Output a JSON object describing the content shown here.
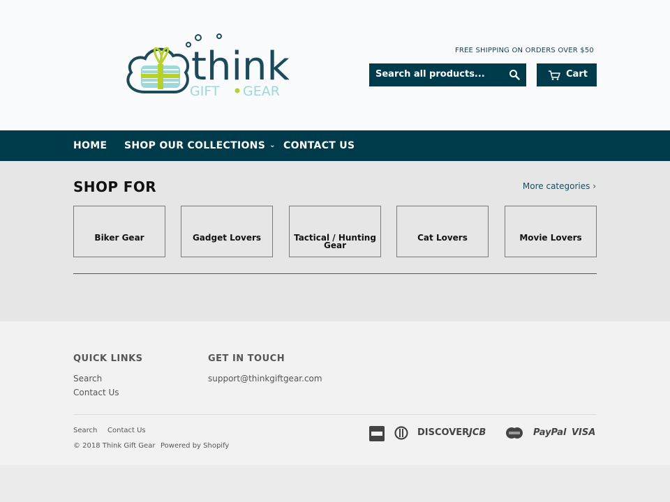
{
  "header": {
    "logo": {
      "word": "think",
      "tagline_left": "GIFT",
      "tagline_right": "GEAR"
    },
    "shipping_note": "FREE SHIPPING ON ORDERS OVER $50",
    "search_placeholder": "Search all products...",
    "cart_label": "Cart"
  },
  "nav": {
    "items": [
      {
        "label": "HOME"
      },
      {
        "label": "SHOP OUR COLLECTIONS"
      },
      {
        "label": "CONTACT US"
      }
    ]
  },
  "main": {
    "title": "SHOP FOR",
    "more_link": "More categories ›",
    "categories": [
      {
        "label": "Biker Gear"
      },
      {
        "label": "Gadget Lovers"
      },
      {
        "label": "Tactical / Hunting Gear"
      },
      {
        "label": "Cat Lovers"
      },
      {
        "label": "Movie Lovers"
      }
    ]
  },
  "footer": {
    "quick_links_heading": "QUICK LINKS",
    "quick_links": [
      "Search",
      "Contact Us"
    ],
    "contact_heading": "GET IN TOUCH",
    "email": "support@thinkgiftgear.com",
    "bottom_links": [
      "Search",
      "Contact Us"
    ],
    "copyright": "© 2018 Think Gift Gear",
    "powered_by": "Powered by Shopify",
    "payment_icons": [
      "american-express",
      "diners-club",
      "discover",
      "jcb",
      "master",
      "paypal",
      "visa"
    ],
    "payment_labels": {
      "discover": "DISCOVER",
      "jcb": "JCB",
      "paypal": "PayPal",
      "visa": "VISA"
    }
  },
  "colors": {
    "brand": "#003b4c",
    "logo_teal": "#1d4a5a",
    "logo_lime": "#b6d12a",
    "logo_aqua": "#9fd8d8"
  }
}
